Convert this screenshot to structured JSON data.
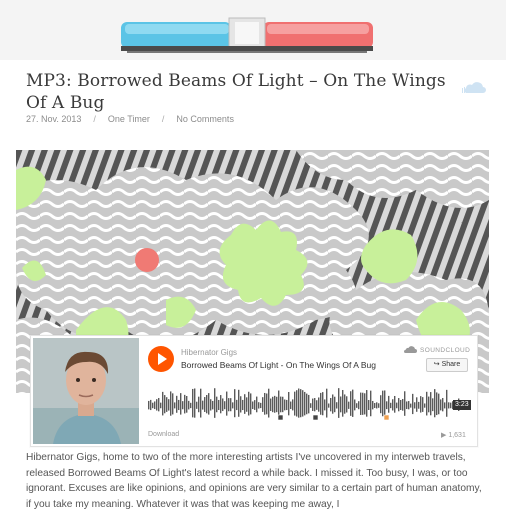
{
  "post": {
    "title": "MP3: Borrowed Beams Of Light – On The Wings Of A Bug",
    "date": "27. Nov. 2013",
    "category": "One Timer",
    "comments": "No Comments"
  },
  "header": {
    "logo_icon": "siren-light-icon"
  },
  "soundcloud": {
    "user": "Hibernator Gigs",
    "track": "Borrowed Beams Of Light - On The Wings Of A Bug",
    "logo_text": "SOUNDCLOUD",
    "share_label": "Share",
    "duration": "3:23",
    "download_label": "Download",
    "play_count": "1,631",
    "accent": "#ff5500"
  },
  "body": {
    "paragraph": "Hibernator Gigs, home to two of the more interesting artists I've uncovered in my interweb travels, released Borrowed Beams Of Light's latest record a while back. I missed it. Too busy, I was, or too ignorant. Excuses are like opinions, and opinions are very similar to a certain part of human anatomy, if you take my meaning. Whatever it was that was keeping me away, I"
  },
  "colors": {
    "siren_blue": "#5bc4e6",
    "siren_red": "#f07070",
    "artwork_green": "#c8f09a",
    "artwork_dot": "#f07a74"
  }
}
